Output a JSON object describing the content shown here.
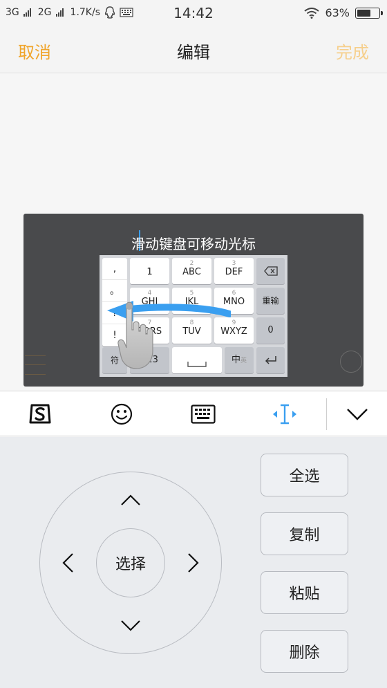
{
  "status_bar": {
    "net1": "3G",
    "net2": "2G",
    "speed": "1.7K/s",
    "time": "14:42",
    "battery": "63%",
    "battery_level": 0.63
  },
  "header": {
    "cancel": "取消",
    "title": "编辑",
    "done": "完成"
  },
  "tutorial": {
    "caption": "滑动键盘可移动光标"
  },
  "mini_keyboard": {
    "symbols": [
      ",",
      "。",
      "?",
      "!"
    ],
    "keys": {
      "k1": "1",
      "k2_sub": "2",
      "k2": "ABC",
      "k3_sub": "3",
      "k3": "DEF",
      "k4_sub": "4",
      "k4": "GHI",
      "k5_sub": "5",
      "k5": "JKL",
      "k6_sub": "6",
      "k6": "MNO",
      "k7_sub": "7",
      "k7": "PQRS",
      "k8_sub": "8",
      "k8": "TUV",
      "k9_sub": "9",
      "k9": "WXYZ",
      "k0": "0",
      "reinput": "重输",
      "fu": "符",
      "num": "123",
      "zh": "中",
      "zh_sub": "英"
    }
  },
  "toolbar": {
    "icons": [
      "sogou-logo-icon",
      "emoji-icon",
      "keyboard-icon",
      "cursor-move-icon",
      "chevron-down-icon"
    ],
    "active_color": "#3a9ff0"
  },
  "panel": {
    "select": "选择",
    "select_all": "全选",
    "copy": "复制",
    "paste": "粘贴",
    "delete": "删除"
  },
  "colors": {
    "accent": "#f0a52c",
    "accent_disabled": "#f6cf8c",
    "cursor_blue": "#3a9ff0"
  }
}
